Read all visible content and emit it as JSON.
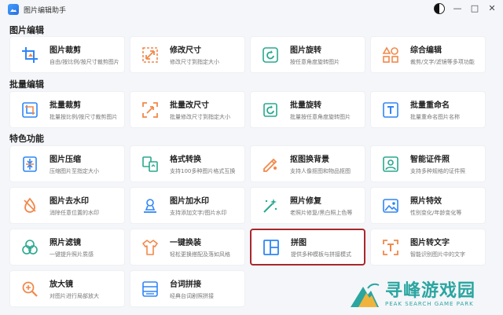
{
  "window": {
    "title": "图片编辑助手",
    "controls": {
      "minimize": "—",
      "maximize": "□",
      "close": "✕"
    }
  },
  "sections": [
    {
      "title": "图片编辑",
      "items": [
        {
          "name": "图片裁剪",
          "desc": "自由/按比例/按尺寸裁剪图片",
          "icon": "crop-icon"
        },
        {
          "name": "修改尺寸",
          "desc": "修改尺寸到指定大小",
          "icon": "resize-icon"
        },
        {
          "name": "图片旋转",
          "desc": "按任意角度旋转图片",
          "icon": "rotate-icon"
        },
        {
          "name": "综合编辑",
          "desc": "裁剪/文字/滤镜等多项功能",
          "icon": "shapes-icon"
        }
      ]
    },
    {
      "title": "批量编辑",
      "items": [
        {
          "name": "批量裁剪",
          "desc": "批量按比例/按尺寸裁剪图片",
          "icon": "batch-crop-icon"
        },
        {
          "name": "批量改尺寸",
          "desc": "批量修改尺寸到指定大小",
          "icon": "batch-resize-icon"
        },
        {
          "name": "批量旋转",
          "desc": "批量按任意角度旋转图片",
          "icon": "batch-rotate-icon"
        },
        {
          "name": "批量重命名",
          "desc": "批量重命名图片名称",
          "icon": "rename-icon"
        }
      ]
    },
    {
      "title": "特色功能",
      "items": [
        {
          "name": "图片压缩",
          "desc": "压缩图片至指定大小",
          "icon": "compress-icon"
        },
        {
          "name": "格式转换",
          "desc": "支持100多种图片格式互换",
          "icon": "convert-icon"
        },
        {
          "name": "抠图换背景",
          "desc": "支持人像抠图和物品抠图",
          "icon": "cutout-icon"
        },
        {
          "name": "智能证件照",
          "desc": "支持多种规格的证件照",
          "icon": "id-photo-icon"
        },
        {
          "name": "图片去水印",
          "desc": "消除任意位置的水印",
          "icon": "dewatermark-icon"
        },
        {
          "name": "图片加水印",
          "desc": "支持添加文字/图片水印",
          "icon": "add-watermark-icon"
        },
        {
          "name": "照片修复",
          "desc": "老照片修复/黑白照上色等",
          "icon": "magic-wand-icon"
        },
        {
          "name": "照片特效",
          "desc": "性别变化/年龄变化等",
          "icon": "effects-icon"
        },
        {
          "name": "照片滤镜",
          "desc": "一键提升照片质感",
          "icon": "filter-icon"
        },
        {
          "name": "一键换装",
          "desc": "轻松更换搭配及落如风格",
          "icon": "clothes-icon"
        },
        {
          "name": "拼图",
          "desc": "提供多种模板与拼接模式",
          "icon": "collage-icon"
        },
        {
          "name": "图片转文字",
          "desc": "智能识别图片中的文字",
          "icon": "ocr-icon"
        },
        {
          "name": "放大镜",
          "desc": "对图片进行局部放大",
          "icon": "magnifier-icon"
        },
        {
          "name": "台词拼接",
          "desc": "经典台词剧照拼接",
          "icon": "subtitle-icon"
        }
      ]
    }
  ],
  "watermark": {
    "main": "寻峰游戏园",
    "sub": "PEAK SEARCH GAME PARK"
  },
  "colors": {
    "accent": "#2f86f6",
    "orange": "#f2884b",
    "highlight": "#a8272d",
    "brand": "#2aa5a0"
  }
}
